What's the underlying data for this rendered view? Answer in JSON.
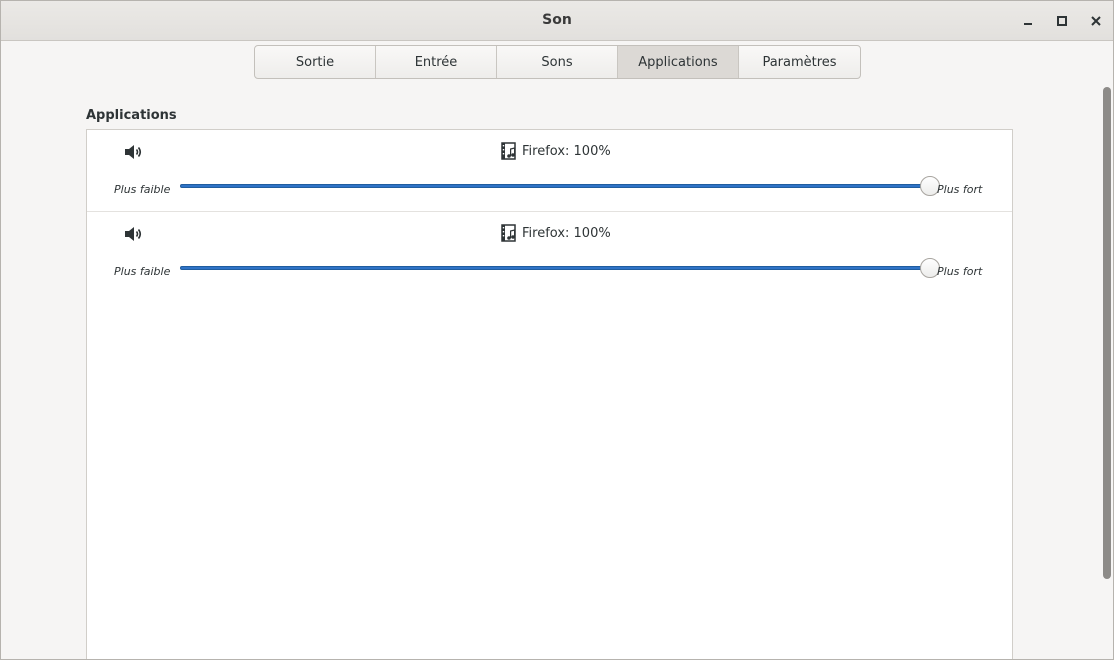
{
  "window": {
    "title": "Son"
  },
  "tabs": [
    {
      "label": "Sortie",
      "active": false
    },
    {
      "label": "Entrée",
      "active": false
    },
    {
      "label": "Sons",
      "active": false
    },
    {
      "label": "Applications",
      "active": true
    },
    {
      "label": "Paramètres",
      "active": false
    }
  ],
  "section": {
    "title": "Applications"
  },
  "applications": [
    {
      "name": "Firefox: 100%",
      "volume_percent": 100,
      "min_label": "Plus faible",
      "max_label": "Plus fort"
    },
    {
      "name": "Firefox: 100%",
      "volume_percent": 100,
      "min_label": "Plus faible",
      "max_label": "Plus fort"
    }
  ],
  "colors": {
    "accent": "#2f73c7",
    "active_tab": "#dcd9d5"
  },
  "icons": {
    "minimize": "minimize-icon",
    "maximize": "maximize-icon",
    "close": "close-icon",
    "speaker": "speaker-icon",
    "app": "film-music-icon"
  }
}
